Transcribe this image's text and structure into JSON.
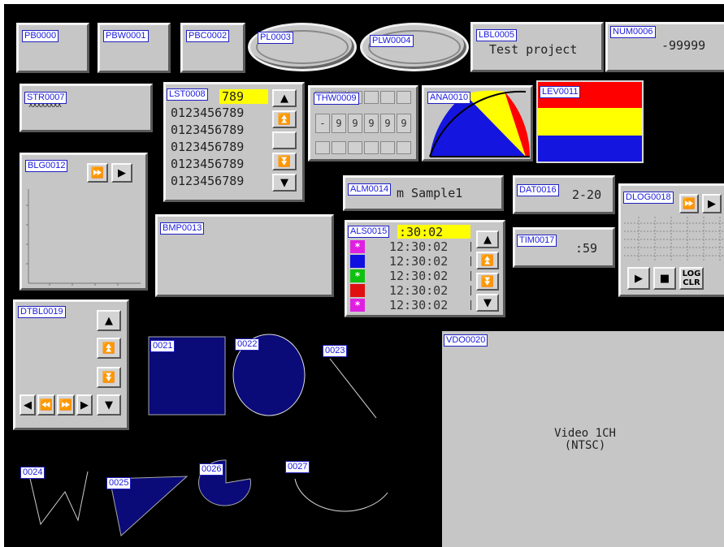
{
  "parts": {
    "pb": "PB0000",
    "pbw": "PBW0001",
    "pbc": "PBC0002",
    "pl": "PL0003",
    "plw": "PLW0004",
    "lbl": "LBL0005",
    "num": "NUM0006",
    "str": "STR0007",
    "lst": "LST0008",
    "thw": "THW0009",
    "ana": "ANA0010",
    "lev": "LEV0011",
    "blg": "BLG0012",
    "bmp": "BMP0013",
    "alm": "ALM0014",
    "als": "ALS0015",
    "dat": "DAT0016",
    "tim": "TIM0017",
    "dlog": "DLOG0018",
    "dtbl": "DTBL0019",
    "vdo": "VDO0020",
    "s21": "0021",
    "s22": "0022",
    "s23": "0023",
    "s24": "0024",
    "s25": "0025",
    "s26": "0026",
    "s27": "0027"
  },
  "label_text": "Test project",
  "numeric_value": "-99999",
  "string_value": "xxxxxxxx",
  "list": {
    "first_item": "789",
    "items": [
      "0123456789",
      "0123456789",
      "0123456789",
      "0123456789",
      "0123456789"
    ]
  },
  "thumbwheel": {
    "sign": "-",
    "digits": [
      "9",
      "9",
      "9",
      "9",
      "9"
    ]
  },
  "alarm_text": "m Sample1",
  "date_value": "2-20",
  "time_value": ":59",
  "alarm_list": {
    "first_time": ":30:02",
    "rows": [
      {
        "mark": "*",
        "color": "#e020e0",
        "time": "12:30:02"
      },
      {
        "mark": "",
        "color": "#1010e0",
        "time": "12:30:02"
      },
      {
        "mark": "*",
        "color": "#10c010",
        "time": "12:30:02"
      },
      {
        "mark": "",
        "color": "#e01010",
        "time": "12:30:02"
      },
      {
        "mark": "*",
        "color": "#e020e0",
        "time": "12:30:02"
      }
    ]
  },
  "datalog": {
    "log_clear_line1": "LOG",
    "log_clear_line2": "CLR"
  },
  "video": {
    "line1": "Video 1CH",
    "line2": "(NTSC)"
  },
  "colors": {
    "screen_bg": "#000000",
    "fill_navy": "#0a0a78",
    "tag_text": "#1a1ae0",
    "level_red": "#ff0000",
    "level_yellow": "#ffff00",
    "level_blue": "#1515e0",
    "list_highlight": "#ffff00"
  },
  "icons": {
    "up": "▲",
    "down": "▼",
    "page_up": "⏫",
    "page_down": "⏬",
    "right": "▶",
    "fast_forward": "⏩",
    "left": "◀",
    "fast_back": "⏪",
    "stop": "■"
  }
}
